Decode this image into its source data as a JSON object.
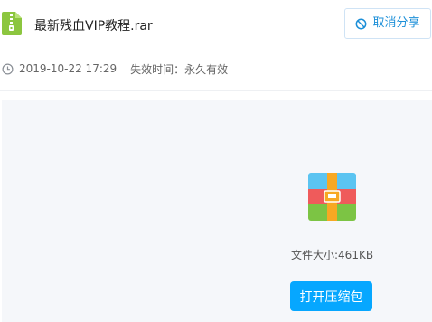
{
  "file": {
    "icon": "archive-file-icon",
    "name": "最新残血VIP教程.rar"
  },
  "actions": {
    "cancel_share_label": "取消分享",
    "cancel_share_icon": "ban-icon"
  },
  "meta": {
    "clock_icon": "clock-icon",
    "shared_date": "2019-10-22 17:29",
    "expiry_text": "失效时间：永久有效"
  },
  "preview": {
    "archive_icon": "winrar-archive-icon",
    "file_size_text": "文件大小:461KB",
    "open_button_label": "打开压缩包"
  },
  "colors": {
    "accent": "#06a7ff",
    "link_blue": "#1c8fd8",
    "file_icon_green": "#8cc63f",
    "panel_background": "#f5f7fa"
  }
}
